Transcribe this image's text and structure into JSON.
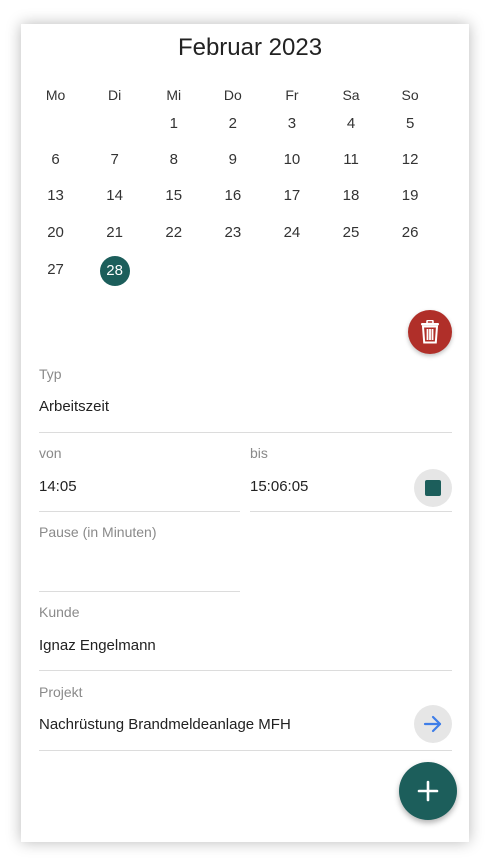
{
  "calendar": {
    "month_title": "Februar 2023",
    "weekdays": [
      "Mo",
      "Di",
      "Mi",
      "Do",
      "Fr",
      "Sa",
      "So"
    ],
    "weeks": [
      [
        "",
        "",
        "1",
        "2",
        "3",
        "4",
        "5"
      ],
      [
        "6",
        "7",
        "8",
        "9",
        "10",
        "11",
        "12"
      ],
      [
        "13",
        "14",
        "15",
        "16",
        "17",
        "18",
        "19"
      ],
      [
        "20",
        "21",
        "22",
        "23",
        "24",
        "25",
        "26"
      ],
      [
        "27",
        "28",
        "",
        "",
        "",
        "",
        ""
      ]
    ],
    "selected_day": "28",
    "selected_color": "#1c5e5b"
  },
  "actions": {
    "delete_icon": "trash-icon",
    "delete_color": "#b02f29",
    "stop_icon": "stop-icon",
    "navigate_icon": "arrow-right-icon",
    "add_icon": "plus-icon",
    "accent_color": "#1c5e5b"
  },
  "form": {
    "typ_label": "Typ",
    "typ_value": "Arbeitszeit",
    "von_label": "von",
    "von_value": "14:05",
    "bis_label": "bis",
    "bis_value": "15:06:05",
    "pause_label": "Pause (in Minuten)",
    "pause_value": "",
    "kunde_label": "Kunde",
    "kunde_value": "Ignaz Engelmann",
    "projekt_label": "Projekt",
    "projekt_value": "Nachrüstung Brandmeldeanlage MFH"
  }
}
